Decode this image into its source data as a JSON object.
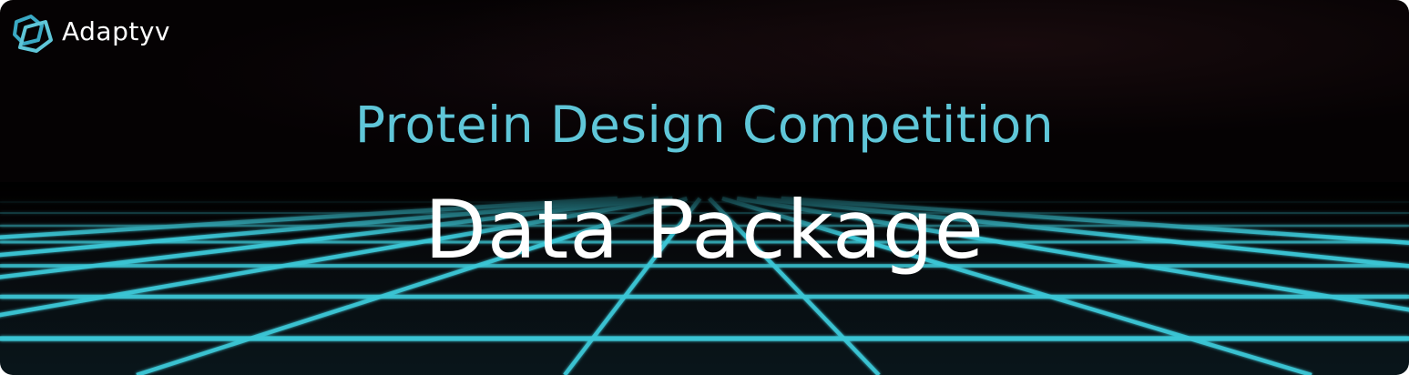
{
  "brand": {
    "name": "Adaptyv",
    "logo_icon": "adaptyv-logo-icon"
  },
  "banner": {
    "subtitle": "Protein Design Competition",
    "title": "Data Package",
    "background_color": "#050203",
    "subtitle_color": "#5fc6d8",
    "title_color": "#ffffff",
    "grid_color": "#3cc7d6",
    "grid_icon": "perspective-grid-floor"
  }
}
